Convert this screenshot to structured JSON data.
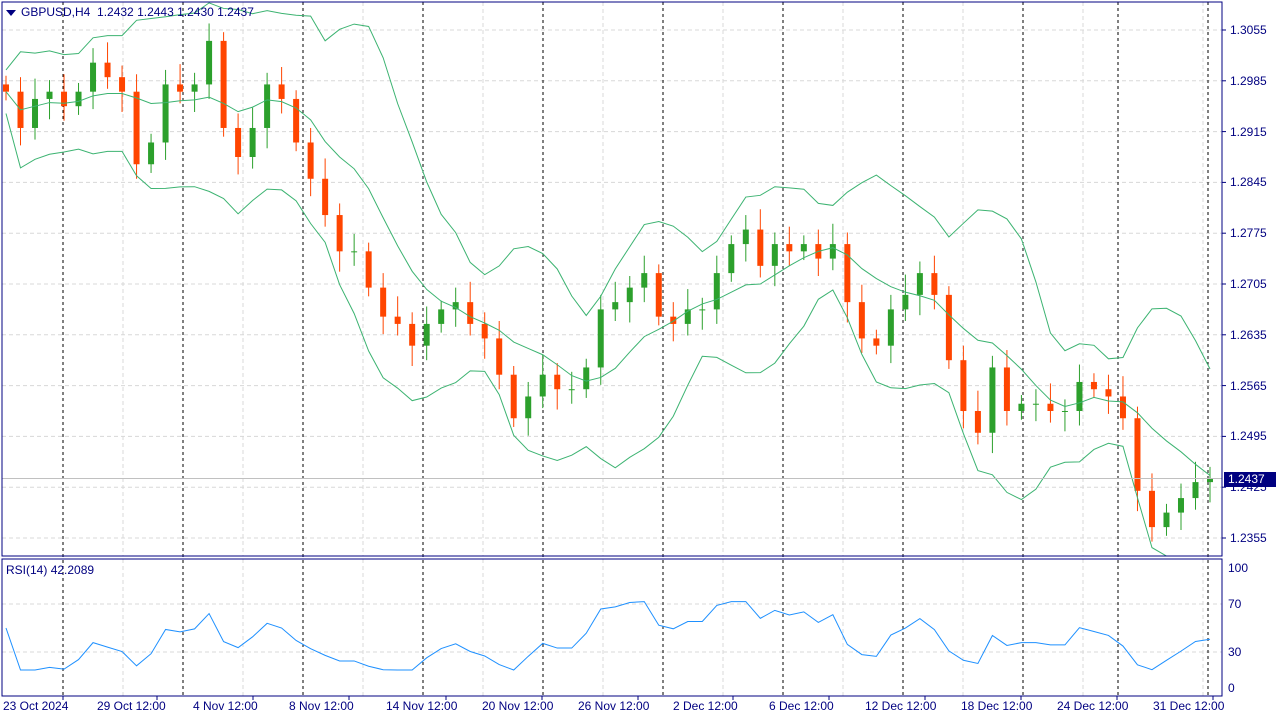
{
  "header": {
    "symbol": "GBPUSD,H4",
    "open": "1.2432",
    "high": "1.2443",
    "low": "1.2430",
    "close": "1.2437"
  },
  "rsi": {
    "label": "RSI(14)",
    "value": "42.2089"
  },
  "current_price": "1.2437",
  "colors": {
    "bull": "#2ca02c",
    "bear": "#ff4500",
    "bands": "#3cb371",
    "rsi": "#1e90ff",
    "axis": "#000080",
    "grid": "#d8d8d8"
  },
  "chart_data": {
    "type": "candlestick",
    "title": "GBPUSD,H4",
    "price_ticks": [
      "1.3055",
      "1.2985",
      "1.2915",
      "1.2845",
      "1.2775",
      "1.2705",
      "1.2635",
      "1.2565",
      "1.2495",
      "1.2425",
      "1.2355"
    ],
    "ylim": [
      1.2325,
      1.309
    ],
    "rsi_ticks": [
      "100",
      "70",
      "30",
      "0"
    ],
    "time_labels": [
      "23 Oct 2024",
      "29 Oct 12:00",
      "4 Nov 12:00",
      "8 Nov 12:00",
      "14 Nov 12:00",
      "20 Nov 12:00",
      "26 Nov 12:00",
      "2 Dec 12:00",
      "6 Dec 12:00",
      "12 Dec 12:00",
      "18 Dec 12:00",
      "24 Dec 12:00",
      "31 Dec 12:00"
    ],
    "closes": [
      1.297,
      1.292,
      1.296,
      1.297,
      1.295,
      1.297,
      1.301,
      1.299,
      1.297,
      1.287,
      1.29,
      1.298,
      1.297,
      1.298,
      1.304,
      1.292,
      1.288,
      1.292,
      1.298,
      1.296,
      1.29,
      1.285,
      1.28,
      1.275,
      1.275,
      1.27,
      1.266,
      1.265,
      1.262,
      1.265,
      1.267,
      1.268,
      1.265,
      1.263,
      1.258,
      1.252,
      1.255,
      1.258,
      1.256,
      1.256,
      1.259,
      1.267,
      1.268,
      1.27,
      1.272,
      1.266,
      1.265,
      1.267,
      1.267,
      1.272,
      1.276,
      1.278,
      1.273,
      1.276,
      1.275,
      1.276,
      1.274,
      1.276,
      1.268,
      1.263,
      1.262,
      1.267,
      1.269,
      1.272,
      1.269,
      1.26,
      1.253,
      1.25,
      1.259,
      1.253,
      1.254,
      1.254,
      1.253,
      1.253,
      1.257,
      1.256,
      1.255,
      1.252,
      1.242,
      1.237,
      1.239,
      1.241,
      1.2432,
      1.2437
    ]
  }
}
